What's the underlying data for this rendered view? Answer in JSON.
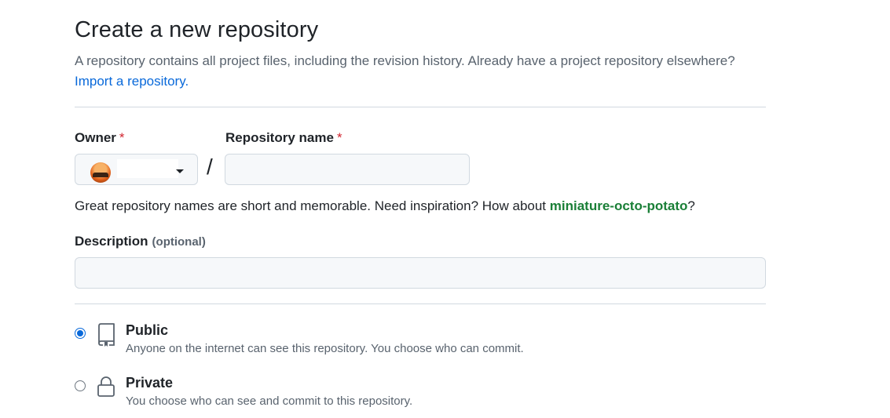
{
  "header": {
    "title": "Create a new repository",
    "description": "A repository contains all project files, including the revision history. Already have a project repository elsewhere?",
    "import_link": "Import a repository."
  },
  "owner": {
    "label": "Owner",
    "required_mark": "*",
    "selected": "",
    "icon": "chevron-down-icon"
  },
  "repo_name": {
    "label": "Repository name",
    "required_mark": "*",
    "value": "",
    "separator": "/"
  },
  "name_hint": {
    "text": "Great repository names are short and memorable. Need inspiration? How about",
    "suggestion": "miniature-octo-potato",
    "suffix": "?"
  },
  "description_field": {
    "label": "Description",
    "optional": "(optional)",
    "value": ""
  },
  "visibility": [
    {
      "title": "Public",
      "description": "Anyone on the internet can see this repository. You choose who can commit.",
      "checked": true,
      "icon": "repo-book-icon"
    },
    {
      "title": "Private",
      "description": "You choose who can see and commit to this repository.",
      "checked": false,
      "icon": "lock-icon"
    }
  ],
  "colors": {
    "link": "#0969da",
    "suggestion": "#1a7f37",
    "required": "#d1242f",
    "input_bg": "#f6f8fa",
    "border": "#d1d9e0"
  }
}
